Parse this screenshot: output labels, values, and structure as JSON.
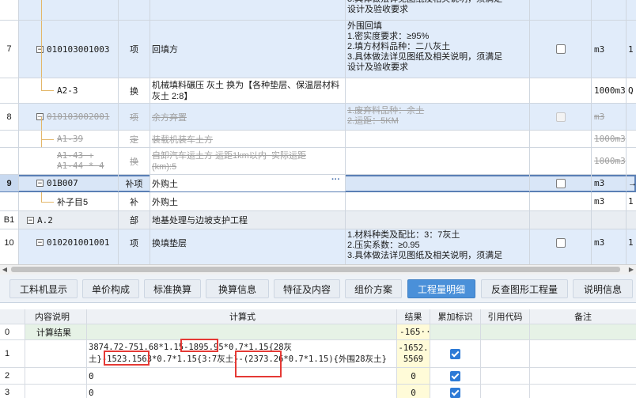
{
  "grid": {
    "rows": [
      {
        "id": "r-top",
        "idx": "",
        "code": "",
        "type": "",
        "name": "",
        "feat": "3.具体做法详见图纸及相关说明，须满足\n设计及验收要求",
        "unit": "",
        "more": ""
      },
      {
        "id": "r7",
        "idx": "7",
        "code": "010103001003",
        "type": "项",
        "name": "回填方",
        "feat": "外围回填\n1.密实度要求：≥95%\n2.填方材料品种：二八灰土\n3.具体做法详见图纸及相关说明，须满足\n设计及验收要求",
        "unit": "m3",
        "more": "1"
      },
      {
        "id": "ra23",
        "idx": "",
        "code": "A2-3",
        "type": "换",
        "name": "机械填料碾压 灰土  换为【各种垫层、保温层材料 灰土 2:8】",
        "feat": "",
        "unit": "1000m3",
        "more": "Q"
      },
      {
        "id": "r8",
        "idx": "8",
        "code": "010103002001",
        "type": "项",
        "name": "余方弃置",
        "feat": "1.废弃料品种：余土\n2.运距：5KM",
        "unit": "m3",
        "more": ""
      },
      {
        "id": "ra139",
        "idx": "",
        "code": "A1-39",
        "type": "定",
        "name": "装载机装车土方",
        "feat": "",
        "unit": "1000m3",
        "more": ""
      },
      {
        "id": "ra143",
        "idx": "",
        "code": "A1-43 +\nA1-44 * 4",
        "type": "换",
        "name": "自卸汽车运土方 运距1km以内  实际运距\n(km):5",
        "feat": "",
        "unit": "1000m3",
        "more": ""
      },
      {
        "id": "r9",
        "idx": "9",
        "code": "01B007",
        "type": "补项",
        "name": "外购土",
        "feat": "",
        "unit": "m3",
        "more": "→"
      },
      {
        "id": "rsub5",
        "idx": "",
        "code": "补子目5",
        "type": "补",
        "name": "外购土",
        "feat": "",
        "unit": "m3",
        "more": "1"
      },
      {
        "id": "rb1",
        "idx": "B1",
        "code": "A.2",
        "type": "部",
        "name": "地基处理与边坡支护工程",
        "feat": "",
        "unit": "",
        "more": ""
      },
      {
        "id": "r10",
        "idx": "10",
        "code": "010201001001",
        "type": "项",
        "name": "换填垫层",
        "feat": "1.材料种类及配比：3：7灰土\n2.压实系数：≥0.95\n3.具体做法详见图纸及相关说明，须满足",
        "unit": "m3",
        "more": "1"
      }
    ]
  },
  "tabs": [
    {
      "label": "工料机显示"
    },
    {
      "label": "单价构成"
    },
    {
      "label": "标准换算"
    },
    {
      "label": "换算信息"
    },
    {
      "label": "特征及内容"
    },
    {
      "label": "组价方案"
    },
    {
      "label": "工程量明细"
    },
    {
      "label": "反查图形工程量"
    },
    {
      "label": "说明信息"
    }
  ],
  "active_tab": "工程量明细",
  "detail": {
    "headers": {
      "desc": "内容说明",
      "formula": "计算式",
      "result": "结果",
      "accum": "累加标识",
      "ref": "引用代码",
      "note": "备注"
    },
    "rows": [
      {
        "idx": "0",
        "desc": "计算结果",
        "formula": "",
        "result": "-165···"
      },
      {
        "idx": "1",
        "desc": "",
        "formula_line1": "3874.72-751.68*1.15-1895.95*0.7*1.15{28灰",
        "formula_line2": "土}-1523.1563*0.7*1.15{3:7灰土}-(2373.26*0.7*1.15){外围28灰土}",
        "result_line1": "-1652.",
        "result_line2": "5569"
      },
      {
        "idx": "2",
        "desc": "",
        "formula": "0",
        "result": "0"
      },
      {
        "idx": "3",
        "desc": "",
        "formula": "0",
        "result": "0"
      }
    ]
  },
  "colors": {
    "accent": "#4a90d9",
    "highlight": "#e53935",
    "row_blue": "#e1ecfa"
  }
}
